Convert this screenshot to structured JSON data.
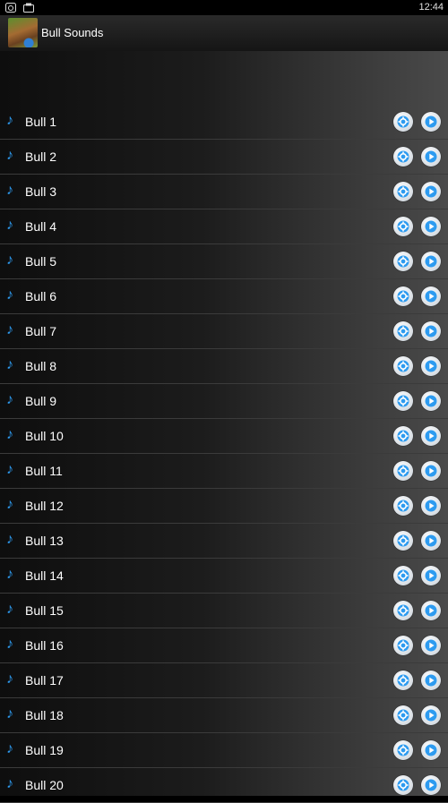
{
  "statusbar": {
    "time": "12:44"
  },
  "app": {
    "title": "Bull Sounds"
  },
  "sounds": [
    "Bull 1",
    "Bull 2",
    "Bull 3",
    "Bull 4",
    "Bull 5",
    "Bull 6",
    "Bull 7",
    "Bull 8",
    "Bull 9",
    "Bull 10",
    "Bull 11",
    "Bull 12",
    "Bull 13",
    "Bull 14",
    "Bull 15",
    "Bull 16",
    "Bull 17",
    "Bull 18",
    "Bull 19",
    "Bull 20"
  ],
  "colors": {
    "accent": "#2d9bf0",
    "text": "#ffffff"
  }
}
